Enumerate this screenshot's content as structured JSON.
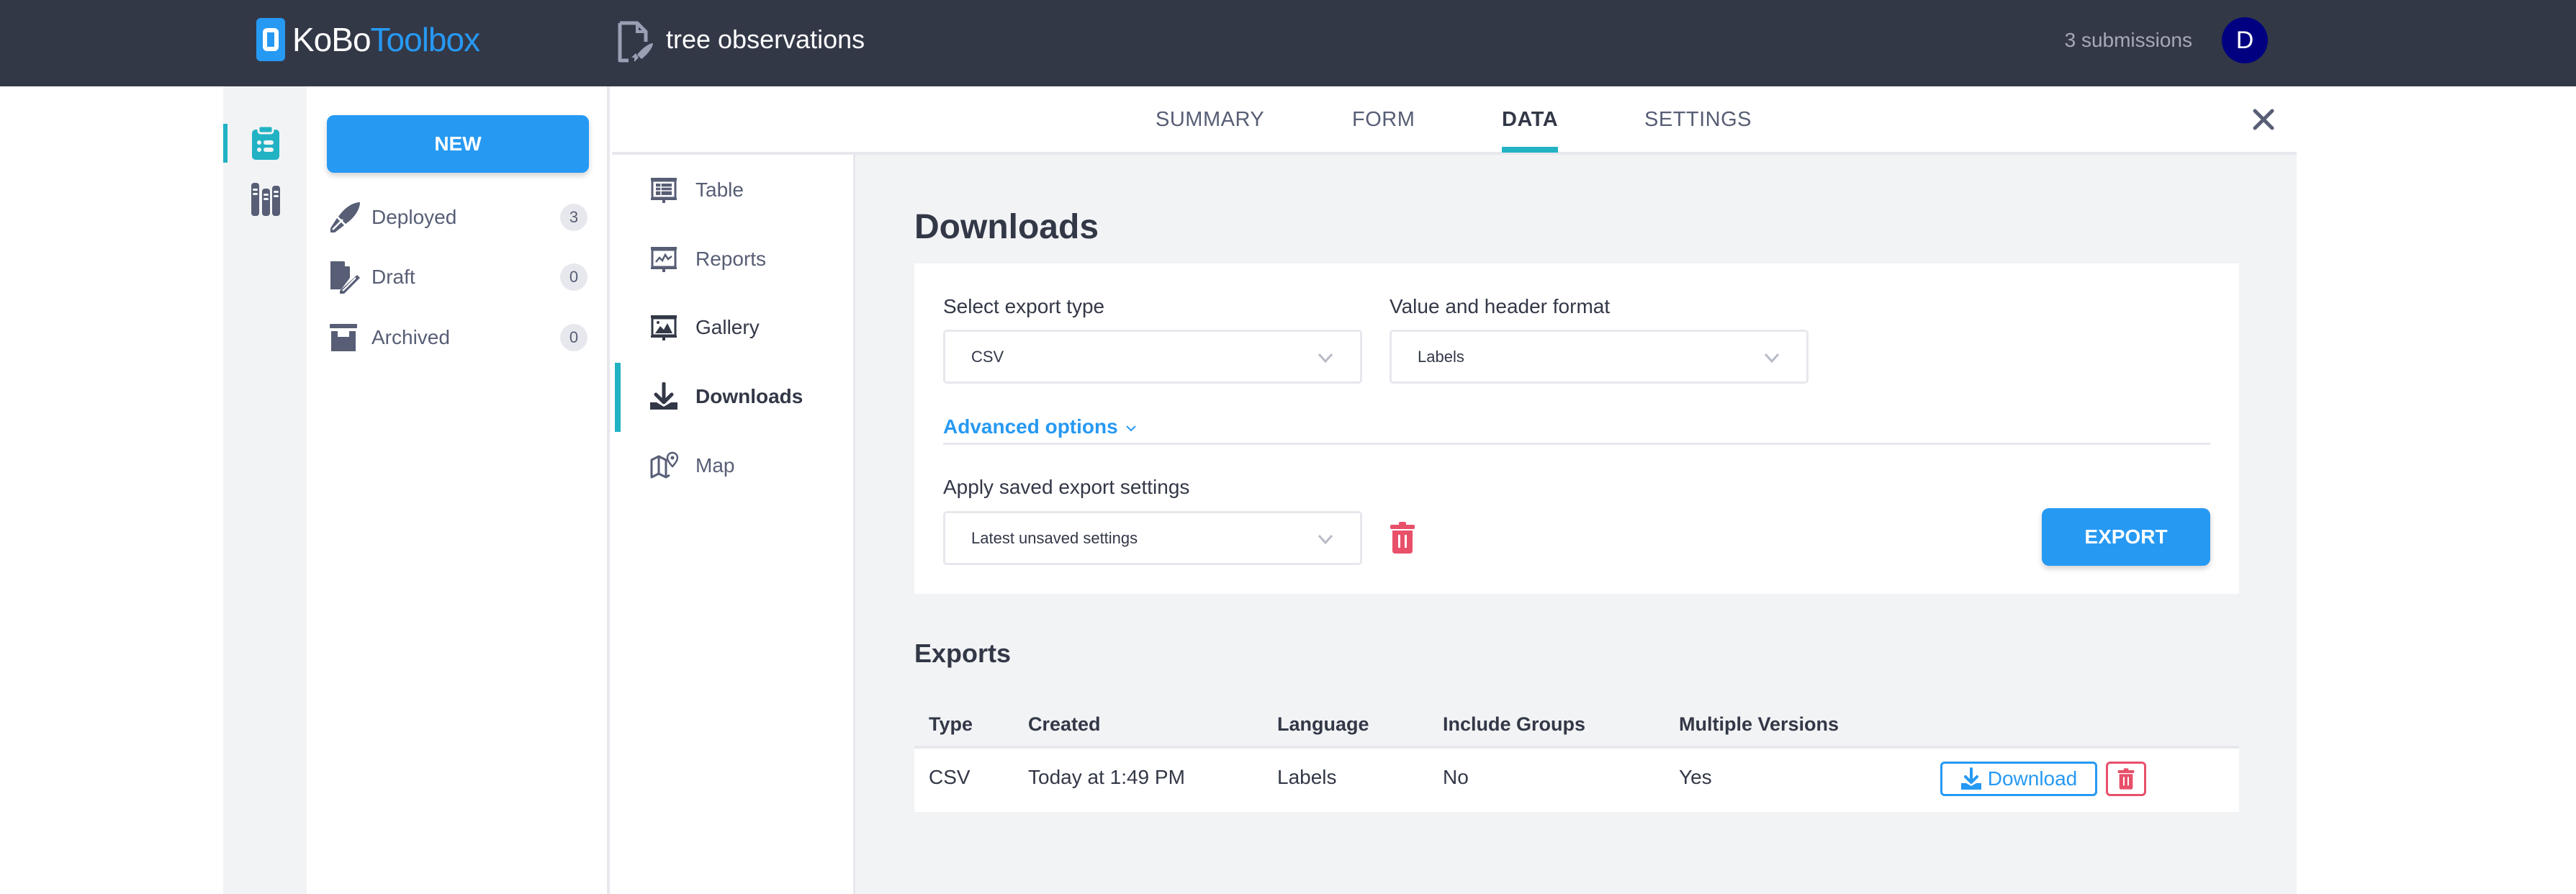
{
  "header": {
    "logo_part1": "KoBo",
    "logo_part2": "Toolbox",
    "form_title": "tree observations",
    "submissions": "3 submissions",
    "avatar_initial": "D",
    "colors": {
      "header_bg": "#333847",
      "brand_blue": "#2699f3",
      "avatar_bg": "#000080"
    }
  },
  "rail": {
    "items": [
      {
        "name": "projects",
        "icon": "clipboard-list-icon",
        "active": true
      },
      {
        "name": "library",
        "icon": "library-books-icon",
        "active": false
      }
    ]
  },
  "sidebar": {
    "new_label": "NEW",
    "items": [
      {
        "label": "Deployed",
        "count": "3",
        "icon": "rocket-icon"
      },
      {
        "label": "Draft",
        "count": "0",
        "icon": "draft-edit-icon"
      },
      {
        "label": "Archived",
        "count": "0",
        "icon": "archive-box-icon"
      }
    ]
  },
  "tabs": [
    {
      "label": "SUMMARY",
      "active": false
    },
    {
      "label": "FORM",
      "active": false
    },
    {
      "label": "DATA",
      "active": true
    },
    {
      "label": "SETTINGS",
      "active": false
    }
  ],
  "subnav": [
    {
      "label": "Table",
      "icon": "table-icon",
      "active": false
    },
    {
      "label": "Reports",
      "icon": "reports-icon",
      "active": false
    },
    {
      "label": "Gallery",
      "icon": "gallery-icon",
      "active": false
    },
    {
      "label": "Downloads",
      "icon": "download-icon",
      "active": true
    },
    {
      "label": "Map",
      "icon": "map-icon",
      "active": false
    }
  ],
  "downloads": {
    "title": "Downloads",
    "export_type_label": "Select export type",
    "export_type_value": "CSV",
    "format_label": "Value and header format",
    "format_value": "Labels",
    "advanced_options": "Advanced options",
    "saved_settings_label": "Apply saved export settings",
    "saved_settings_value": "Latest unsaved settings",
    "export_button": "EXPORT"
  },
  "exports": {
    "title": "Exports",
    "columns": [
      "Type",
      "Created",
      "Language",
      "Include Groups",
      "Multiple Versions"
    ],
    "rows": [
      {
        "type": "CSV",
        "created": "Today at 1:49 PM",
        "language": "Labels",
        "include_groups": "No",
        "multiple_versions": "Yes",
        "download_label": "Download"
      }
    ]
  },
  "colors": {
    "accent_teal": "#21b2c4",
    "danger_red": "#e8506a",
    "content_bg": "#f2f3f5",
    "text_dark": "#333847",
    "text_muted": "#575e75"
  }
}
